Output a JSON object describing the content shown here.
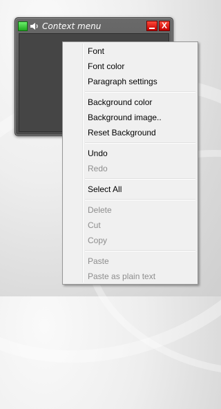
{
  "window": {
    "title": "Context menu",
    "icons": [
      "app-square-icon",
      "speaker-icon"
    ],
    "minimize_icon": "minimize-icon",
    "close_label": "X"
  },
  "menu": {
    "groups": [
      [
        {
          "label": "Font",
          "enabled": true
        },
        {
          "label": "Font color",
          "enabled": true
        },
        {
          "label": "Paragraph settings",
          "enabled": true
        }
      ],
      [
        {
          "label": "Background color",
          "enabled": true
        },
        {
          "label": "Background image..",
          "enabled": true
        },
        {
          "label": "Reset Background",
          "enabled": true
        }
      ],
      [
        {
          "label": "Undo",
          "enabled": true
        },
        {
          "label": "Redo",
          "enabled": false
        }
      ],
      [
        {
          "label": "Select All",
          "enabled": true
        }
      ],
      [
        {
          "label": "Delete",
          "enabled": false
        },
        {
          "label": "Cut",
          "enabled": false
        },
        {
          "label": "Copy",
          "enabled": false
        }
      ],
      [
        {
          "label": "Paste",
          "enabled": false
        },
        {
          "label": "Paste as plain text",
          "enabled": false
        }
      ]
    ]
  },
  "colors": {
    "menu_background": "#f0f0f0",
    "disabled_text": "#8d8d8d",
    "window_close": "#c40000",
    "app_icon": "#2fbf2f"
  }
}
